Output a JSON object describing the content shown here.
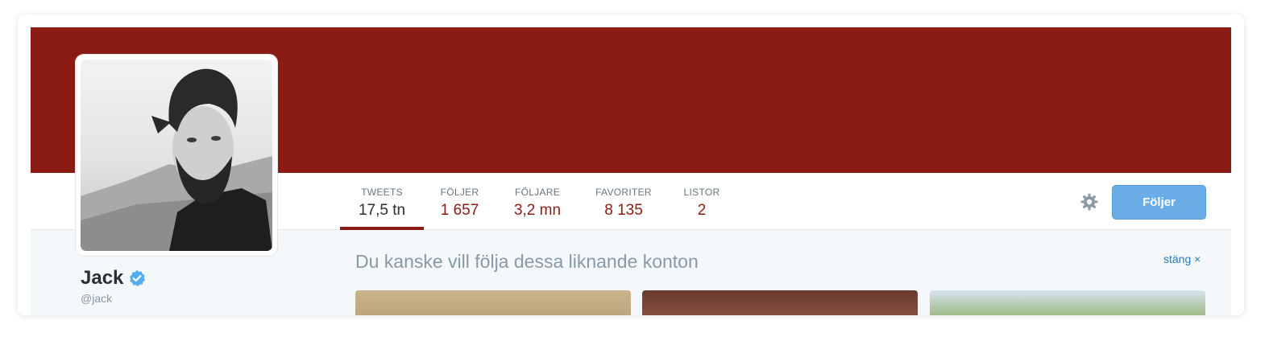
{
  "colors": {
    "banner": "#8b1c15",
    "accent": "#8b1c15",
    "follow_button": "#6aace6",
    "verified": "#55acee",
    "muted_text": "#8899a6",
    "link": "#2b7bb9"
  },
  "stats": {
    "tweets": {
      "label": "TWEETS",
      "value": "17,5 tn",
      "active": true
    },
    "foljer": {
      "label": "FÖLJER",
      "value": "1 657"
    },
    "foljare": {
      "label": "FÖLJARE",
      "value": "3,2 mn"
    },
    "favoriter": {
      "label": "FAVORITER",
      "value": "8 135"
    },
    "listor": {
      "label": "LISTOR",
      "value": "2"
    }
  },
  "actions": {
    "settings_icon": "gear-icon",
    "follow_label": "Följer"
  },
  "profile": {
    "name": "Jack",
    "handle": "@jack",
    "verified_icon": "verified-badge-icon"
  },
  "suggestions": {
    "title": "Du kanske vill följa dessa liknande konton",
    "close_label": "stäng ×"
  }
}
